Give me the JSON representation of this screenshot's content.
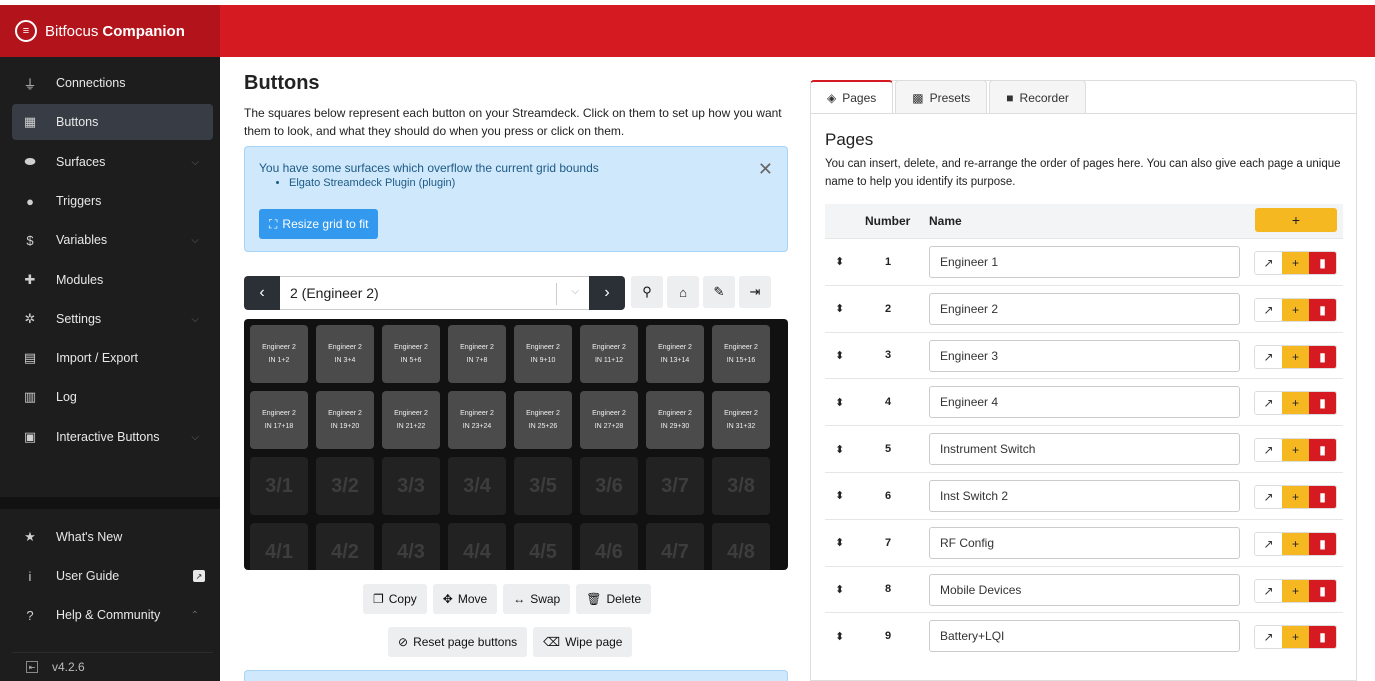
{
  "app": {
    "brand_prefix": "Bitfocus",
    "brand_name": "Companion",
    "version": "v4.2.6"
  },
  "sidebar": {
    "items": [
      {
        "label": "Connections",
        "icon": "plug-icon"
      },
      {
        "label": "Buttons",
        "icon": "grid-icon"
      },
      {
        "label": "Surfaces",
        "icon": "gamepad-icon"
      },
      {
        "label": "Triggers",
        "icon": "clock-icon"
      },
      {
        "label": "Variables",
        "icon": "dollar-icon"
      },
      {
        "label": "Modules",
        "icon": "puzzle-icon"
      },
      {
        "label": "Settings",
        "icon": "cog-icon"
      },
      {
        "label": "Import / Export",
        "icon": "file-import-icon"
      },
      {
        "label": "Log",
        "icon": "clipboard-icon"
      },
      {
        "label": "Interactive Buttons",
        "icon": "square-play-icon"
      }
    ],
    "footer_items": [
      {
        "label": "What's New",
        "icon": "star-icon"
      },
      {
        "label": "User Guide",
        "icon": "info-icon"
      },
      {
        "label": "Help & Community",
        "icon": "question-circle-icon"
      }
    ]
  },
  "main": {
    "title": "Buttons",
    "description": "The squares below represent each button on your Streamdeck. Click on them to set up how you want them to look, and what they should do when you press or click on them.",
    "alert": {
      "message": "You have some surfaces which overflow the current grid bounds",
      "item": "Elgato Streamdeck Plugin (plugin)",
      "button": "Resize grid to fit"
    },
    "page_select": "2 (Engineer 2)",
    "actions_row1": [
      "Copy",
      "Move",
      "Swap",
      "Delete"
    ],
    "actions_row2": [
      "Reset page buttons",
      "Wipe page"
    ],
    "grid": {
      "row1": [
        {
          "title": "Engineer 2",
          "sub": "IN 1+2"
        },
        {
          "title": "Engineer 2",
          "sub": "IN 3+4"
        },
        {
          "title": "Engineer 2",
          "sub": "IN 5+6"
        },
        {
          "title": "Engineer 2",
          "sub": "IN 7+8"
        },
        {
          "title": "Engineer 2",
          "sub": "IN 9+10"
        },
        {
          "title": "Engineer 2",
          "sub": "IN 11+12"
        },
        {
          "title": "Engineer 2",
          "sub": "IN 13+14"
        },
        {
          "title": "Engineer 2",
          "sub": "IN 15+16"
        }
      ],
      "row2": [
        {
          "title": "Engineer 2",
          "sub": "IN 17+18"
        },
        {
          "title": "Engineer 2",
          "sub": "IN 19+20"
        },
        {
          "title": "Engineer 2",
          "sub": "IN 21+22"
        },
        {
          "title": "Engineer 2",
          "sub": "IN 23+24"
        },
        {
          "title": "Engineer 2",
          "sub": "IN 25+26"
        },
        {
          "title": "Engineer 2",
          "sub": "IN 27+28"
        },
        {
          "title": "Engineer 2",
          "sub": "IN 29+30"
        },
        {
          "title": "Engineer 2",
          "sub": "IN 31+32"
        }
      ],
      "row3": [
        "3/1",
        "3/2",
        "3/3",
        "3/4",
        "3/5",
        "3/6",
        "3/7",
        "3/8"
      ],
      "row4": [
        "4/1",
        "4/2",
        "4/3",
        "4/4",
        "4/5",
        "4/6",
        "4/7",
        "4/8"
      ]
    }
  },
  "panel": {
    "tabs": [
      "Pages",
      "Presets",
      "Recorder"
    ],
    "title": "Pages",
    "description": "You can insert, delete, and re-arrange the order of pages here. You can also give each page a unique name to help you identify its purpose.",
    "col_number": "Number",
    "col_name": "Name",
    "add_label": "+",
    "pages": [
      {
        "number": "1",
        "name": "Engineer 1"
      },
      {
        "number": "2",
        "name": "Engineer 2"
      },
      {
        "number": "3",
        "name": "Engineer 3"
      },
      {
        "number": "4",
        "name": "Engineer 4"
      },
      {
        "number": "5",
        "name": "Instrument Switch"
      },
      {
        "number": "6",
        "name": "Inst Switch 2"
      },
      {
        "number": "7",
        "name": "RF Config"
      },
      {
        "number": "8",
        "name": "Mobile Devices"
      },
      {
        "number": "9",
        "name": "Battery+LQI"
      }
    ]
  },
  "colors": {
    "brand_red": "#d51a22",
    "sidebar_bg": "#1d1d1d",
    "accent_yellow": "#f5b820",
    "info_blue": "#3399ee"
  }
}
